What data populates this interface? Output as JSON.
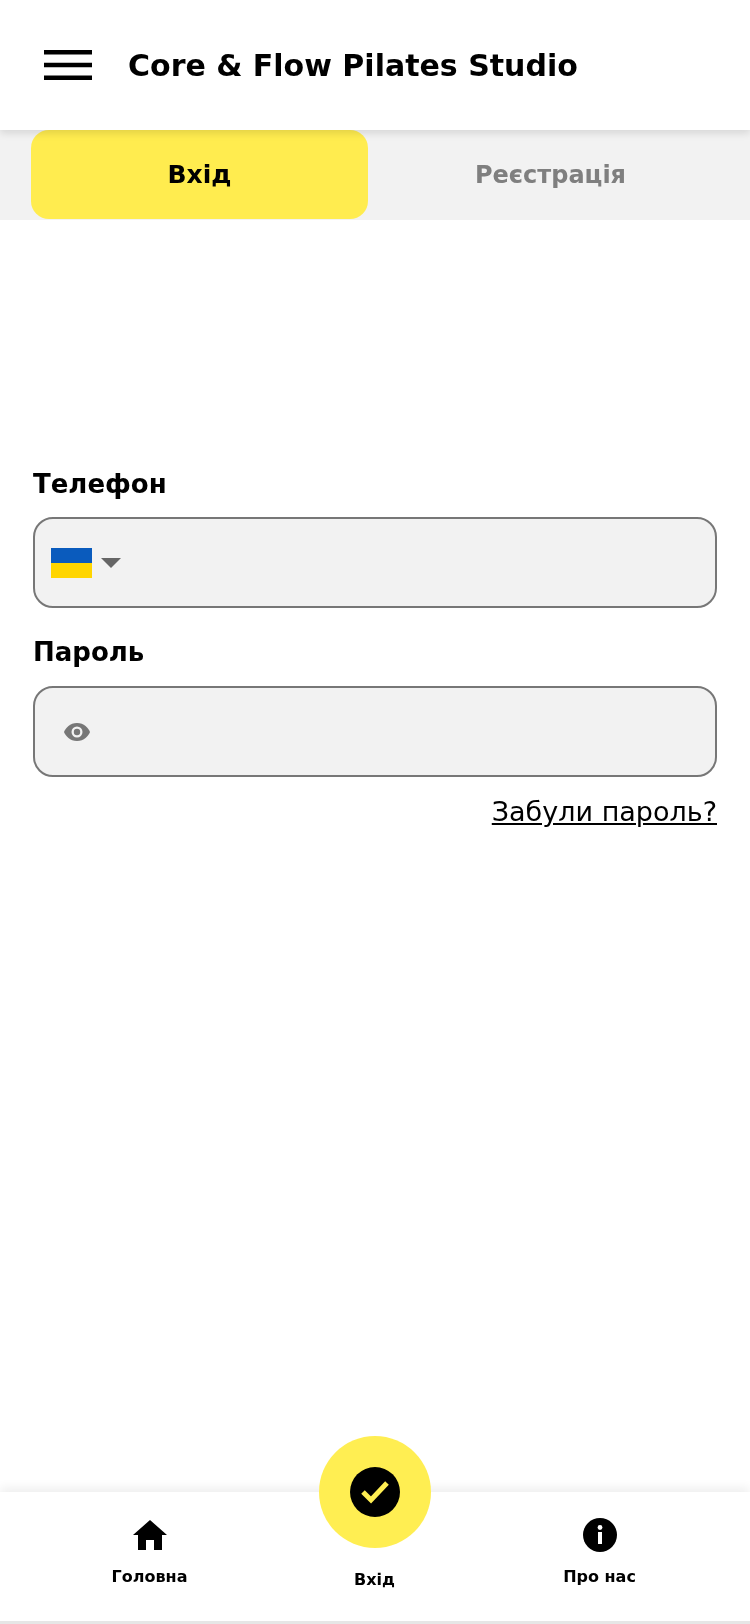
{
  "header": {
    "title": "Core & Flow Pilates Studio"
  },
  "tabs": [
    {
      "label": "Вхід",
      "selected": true
    },
    {
      "label": "Реєстрація",
      "selected": false
    }
  ],
  "form": {
    "phone": {
      "label": "Телефон"
    },
    "password": {
      "label": "Пароль"
    },
    "forgot_link": "Забули пароль?"
  },
  "bottom_nav": [
    {
      "kind": "home",
      "label": "Головна"
    },
    {
      "kind": "login",
      "label": "Вхід"
    },
    {
      "kind": "info",
      "label": "Про нас"
    }
  ]
}
